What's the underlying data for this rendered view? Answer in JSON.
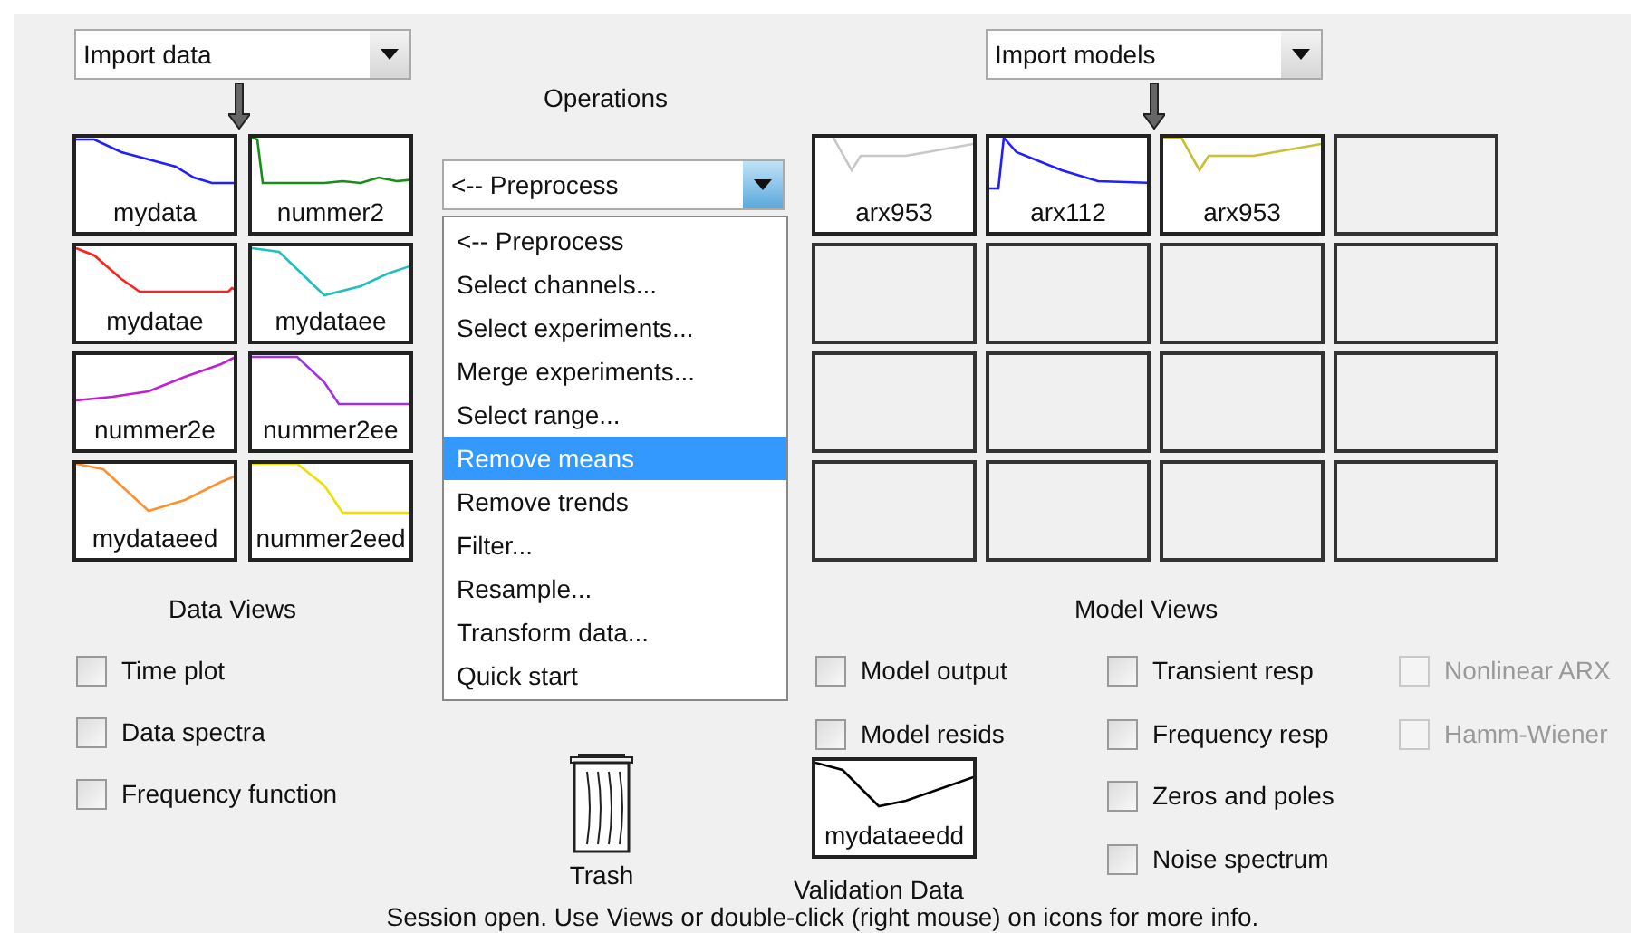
{
  "import_data": {
    "value": "Import data"
  },
  "operations": {
    "title": "Operations",
    "dropdown": {
      "value": "<-- Preprocess",
      "expanded": true
    },
    "menu": [
      {
        "label": "<-- Preprocess",
        "selected": false
      },
      {
        "label": "Select channels...",
        "selected": false
      },
      {
        "label": "Select experiments...",
        "selected": false
      },
      {
        "label": "Merge experiments...",
        "selected": false
      },
      {
        "label": "Select range...",
        "selected": false
      },
      {
        "label": "Remove means",
        "selected": true
      },
      {
        "label": "Remove trends",
        "selected": false
      },
      {
        "label": "Filter...",
        "selected": false
      },
      {
        "label": "Resample...",
        "selected": false
      },
      {
        "label": "Transform data...",
        "selected": false
      },
      {
        "label": "Quick start",
        "selected": false
      }
    ]
  },
  "import_models": {
    "value": "Import models"
  },
  "data_tiles": [
    {
      "label": "mydata",
      "color": "#1f1fff"
    },
    {
      "label": "nummer2",
      "color": "#1a8c1a"
    },
    {
      "label": "mydatae",
      "color": "#ff2020"
    },
    {
      "label": "mydataee",
      "color": "#20c0c0"
    },
    {
      "label": "nummer2e",
      "color": "#c020d0"
    },
    {
      "label": "nummer2ee",
      "color": "#a030f0"
    },
    {
      "label": "mydataeed",
      "color": "#ff9030"
    },
    {
      "label": "nummer2eed",
      "color": "#f0e000"
    }
  ],
  "data_views": {
    "title": "Data Views",
    "options": [
      {
        "label": "Time plot",
        "checked": false
      },
      {
        "label": "Data spectra",
        "checked": false
      },
      {
        "label": "Frequency function",
        "checked": false
      }
    ]
  },
  "model_slots": [
    {
      "kind": "model",
      "label": "arx953",
      "color": "#c8c8c8"
    },
    {
      "kind": "model",
      "label": "arx112",
      "color": "#1f1fff"
    },
    {
      "kind": "model",
      "label": "arx953",
      "color": "#c8c030"
    },
    {
      "kind": "empty"
    },
    {
      "kind": "empty"
    },
    {
      "kind": "empty"
    },
    {
      "kind": "empty"
    },
    {
      "kind": "empty"
    },
    {
      "kind": "empty"
    },
    {
      "kind": "empty"
    },
    {
      "kind": "empty"
    },
    {
      "kind": "empty"
    },
    {
      "kind": "empty"
    },
    {
      "kind": "empty"
    },
    {
      "kind": "empty"
    },
    {
      "kind": "empty"
    }
  ],
  "model_views": {
    "title": "Model Views",
    "columns": [
      [
        {
          "label": "Model output",
          "checked": false,
          "disabled": false
        },
        {
          "label": "Model resids",
          "checked": false,
          "disabled": false
        }
      ],
      [
        {
          "label": "Transient resp",
          "checked": false,
          "disabled": false
        },
        {
          "label": "Frequency resp",
          "checked": false,
          "disabled": false
        },
        {
          "label": "Zeros and poles",
          "checked": false,
          "disabled": false
        },
        {
          "label": "Noise spectrum",
          "checked": false,
          "disabled": false
        }
      ],
      [
        {
          "label": "Nonlinear ARX",
          "checked": false,
          "disabled": true
        },
        {
          "label": "Hamm-Wiener",
          "checked": false,
          "disabled": true
        }
      ]
    ]
  },
  "trash": {
    "label": "Trash"
  },
  "validation": {
    "tile_label": "mydataeedd",
    "color": "#000000",
    "caption": "Validation Data"
  },
  "status": "Session open. Use Views or double-click (right mouse) on icons for more info."
}
